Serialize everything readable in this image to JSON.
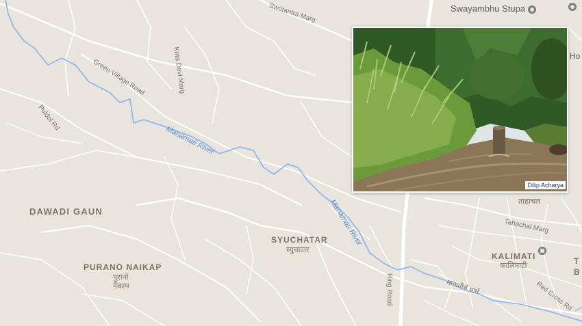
{
  "map": {
    "places": {
      "dawadi_gaun": "DAWADI GAUN",
      "purano_naikap": "PURANO NAIKAP",
      "purano_naikap_dev_1": "पुरानो",
      "purano_naikap_dev_2": "नैकाप",
      "syuchatar": "SYUCHATAR",
      "syuchatar_dev": "स्युचाटार",
      "kalimati": "KALIMATI",
      "kalimati_dev": "कालिमाटी",
      "tahachal_dev": "ताहाचल",
      "edge_t": "T",
      "edge_b": "B",
      "edge_ho": "Ho"
    },
    "roads": {
      "swotantra_marg": "Swotantra Marg",
      "green_village_road": "Green Village Road",
      "kota_devi_marg": "Kota Devi Marg",
      "pulchok_rd": "Puldol Rd",
      "tahachal_marg": "Tahachal Marg",
      "ring_road": "Ring Road",
      "red_cross_rd": "Red Cross Rd",
      "dev_road": "मातातीर्थ मार्ग"
    },
    "rivers": {
      "upper": "Manamati River",
      "lower": "Manamati River"
    },
    "poi": {
      "swayambhu": "Swayambhu Stupa",
      "swayambhu_icon": "camera-pin-icon"
    },
    "colors": {
      "land": "#e9e5dc",
      "road": "#ffffff",
      "river": "#8fb7f0",
      "label": "#7a7468"
    }
  },
  "photo": {
    "credit": "Dilip Acharya",
    "subject": "river-with-reeds"
  }
}
